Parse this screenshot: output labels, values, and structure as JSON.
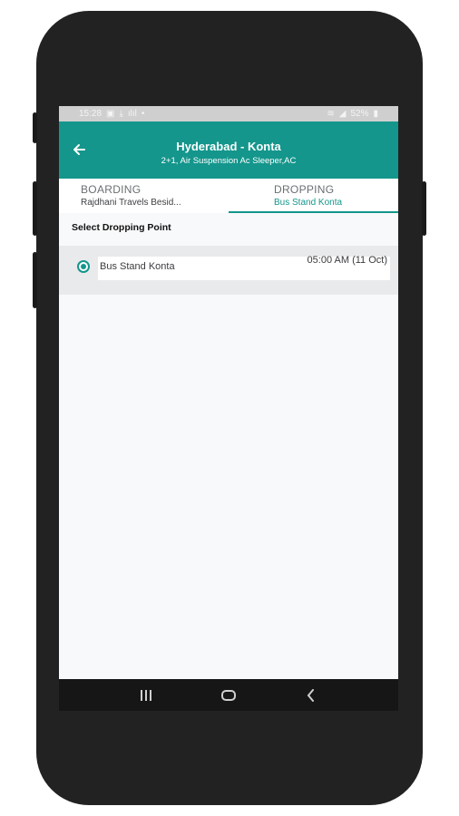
{
  "status_bar": {
    "time": "15:28",
    "battery": "52%"
  },
  "app_bar": {
    "title": "Hyderabad - Konta",
    "subtitle": "2+1, Air Suspension Ac Sleeper,AC"
  },
  "tabs": {
    "boarding": {
      "label": "BOARDING",
      "value": "Rajdhani Travels Besid..."
    },
    "dropping": {
      "label": "DROPPING",
      "value": "Bus Stand Konta"
    }
  },
  "section_label": "Select Dropping Point",
  "dropping_points": [
    {
      "name": "Bus Stand Konta",
      "time": "05:00 AM (11 Oct)",
      "selected": true
    }
  ],
  "colors": {
    "primary": "#14968c",
    "frame": "#222222"
  },
  "icons": {
    "back": "arrow-left-icon",
    "recents": "recents-icon",
    "home": "home-icon",
    "nav_back": "chevron-left-icon"
  }
}
